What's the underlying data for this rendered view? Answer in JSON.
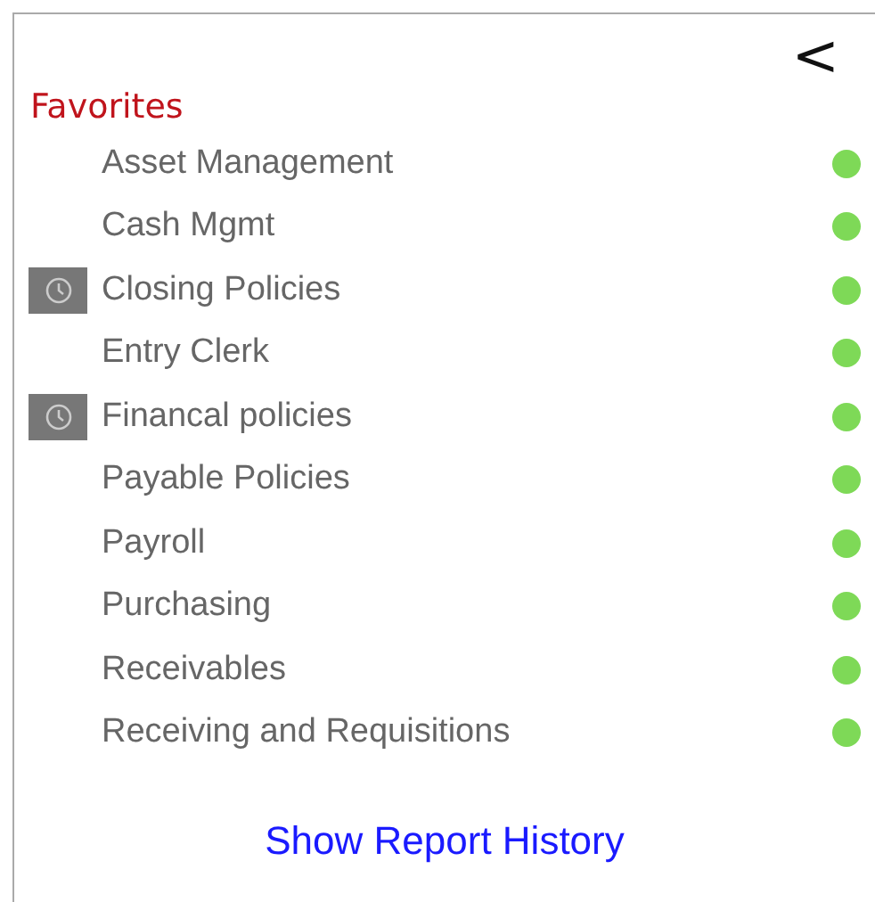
{
  "collapse_button": "<",
  "favorites": {
    "title": "Favorites",
    "items": [
      {
        "label": "Asset Management",
        "scheduled": false,
        "color": "#7ed957"
      },
      {
        "label": "Cash Mgmt",
        "scheduled": false,
        "color": "#7ed957"
      },
      {
        "label": "Closing Policies",
        "scheduled": true,
        "color": "#7ed957"
      },
      {
        "label": "Entry Clerk",
        "scheduled": false,
        "color": "#7ed957"
      },
      {
        "label": "Financal policies",
        "scheduled": true,
        "color": "#7ed957"
      },
      {
        "label": "Payable Policies",
        "scheduled": false,
        "color": "#7ed957"
      },
      {
        "label": "Payroll",
        "scheduled": false,
        "color": "#7ed957"
      },
      {
        "label": "Purchasing",
        "scheduled": false,
        "color": "#7ed957"
      },
      {
        "label": "Receivables",
        "scheduled": false,
        "color": "#7ed957"
      },
      {
        "label": "Receiving and Requisitions",
        "scheduled": false,
        "color": "#7ed957"
      }
    ]
  },
  "history_link": "Show Report History"
}
